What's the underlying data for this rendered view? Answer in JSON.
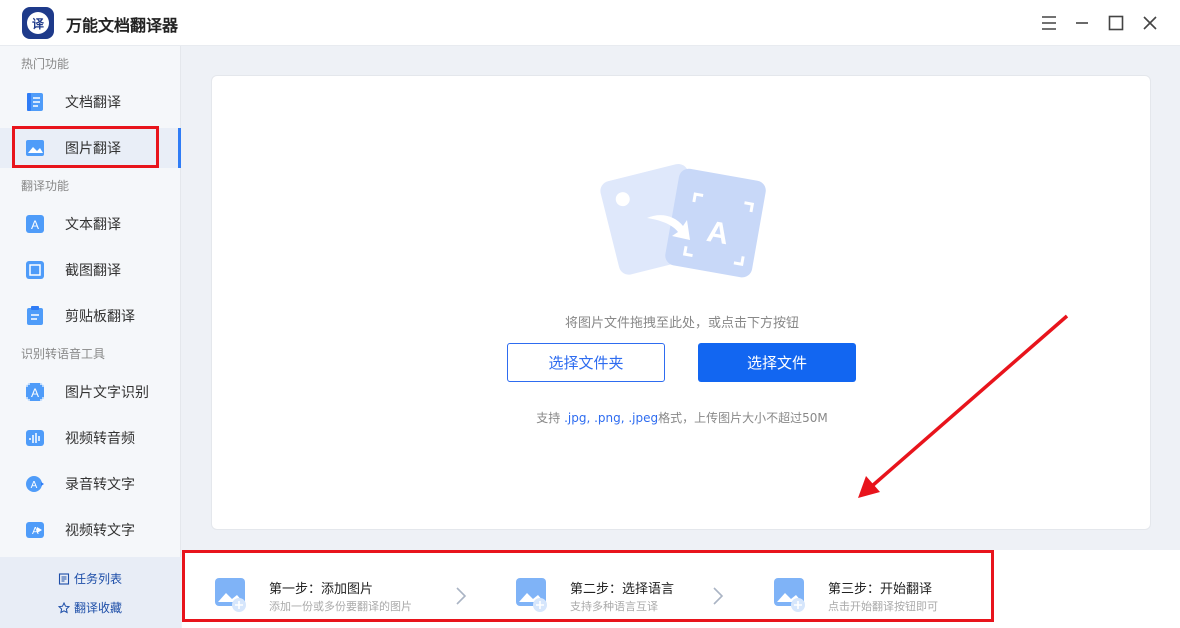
{
  "app": {
    "title": "万能文档翻译器",
    "logo_text": "译"
  },
  "window_controls": [
    "menu-icon",
    "minimize-icon",
    "maximize-icon",
    "close-icon"
  ],
  "sidebar": {
    "sections": [
      {
        "label": "热门功能",
        "items": [
          {
            "label": "文档翻译",
            "icon": "document-icon"
          },
          {
            "label": "图片翻译",
            "icon": "image-icon",
            "active": true
          }
        ]
      },
      {
        "label": "翻译功能",
        "items": [
          {
            "label": "文本翻译",
            "icon": "text-icon"
          },
          {
            "label": "截图翻译",
            "icon": "screenshot-icon"
          },
          {
            "label": "剪贴板翻译",
            "icon": "clipboard-icon"
          }
        ]
      },
      {
        "label": "识别转语音工具",
        "items": [
          {
            "label": "图片文字识别",
            "icon": "ocr-icon"
          },
          {
            "label": "视频转音频",
            "icon": "video-audio-icon"
          },
          {
            "label": "录音转文字",
            "icon": "audio-text-icon"
          },
          {
            "label": "视频转文字",
            "icon": "video-text-icon"
          }
        ]
      }
    ],
    "bottom_links": [
      {
        "label": "任务列表",
        "icon": "list-icon"
      },
      {
        "label": "翻译收藏",
        "icon": "star-icon"
      }
    ]
  },
  "main": {
    "drop_hint": "将图片文件拖拽至此处，或点击下方按钮",
    "select_folder_label": "选择文件夹",
    "select_file_label": "选择文件",
    "support_prefix": "支持",
    "support_formats": " .jpg, .png, .jpeg",
    "support_suffix": "格式，上传图片大小不超过50M"
  },
  "steps": [
    {
      "title": "第一步：添加图片",
      "desc": "添加一份或多份要翻译的图片"
    },
    {
      "title": "第二步：选择语言",
      "desc": "支持多种语言互译"
    },
    {
      "title": "第三步：开始翻译",
      "desc": "点击开始翻译按钮即可"
    }
  ],
  "colors": {
    "accent": "#1266f1",
    "annotation_red": "#e8141c",
    "active_bar": "#2f7cf6"
  }
}
